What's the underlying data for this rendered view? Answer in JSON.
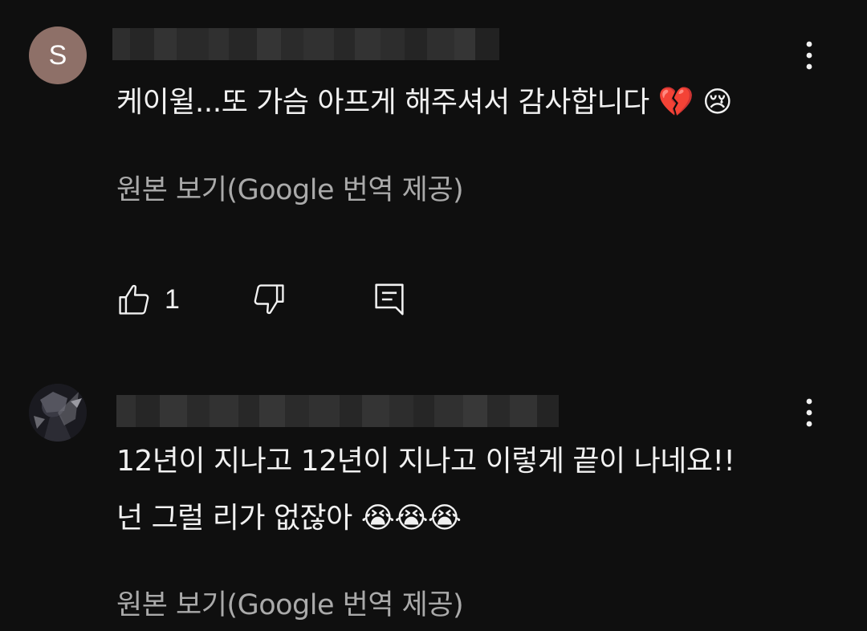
{
  "comments": [
    {
      "avatar_letter": "S",
      "avatar_color": "#8e7068",
      "text": "케이윌...또 가슴 아프게 해주셔서 감사합니다",
      "emojis": "💔 😢",
      "translate_label": "원본 보기(Google 번역 제공)",
      "like_count": "1"
    },
    {
      "text_line1": "12년이 지나고 12년이 지나고 이렇게 끝이 나네요!!",
      "text_line2": "넌 그럴 리가 없잖아",
      "emojis": "😭😭😭",
      "translate_label": "원본 보기(Google 번역 제공)"
    }
  ],
  "icons": {
    "like": "thumbs-up-icon",
    "dislike": "thumbs-down-icon",
    "reply": "reply-icon",
    "more": "more-vertical-icon"
  },
  "colors": {
    "background": "#0f0f0f",
    "text": "#f1f1f1",
    "secondary": "#aaaaaa"
  }
}
